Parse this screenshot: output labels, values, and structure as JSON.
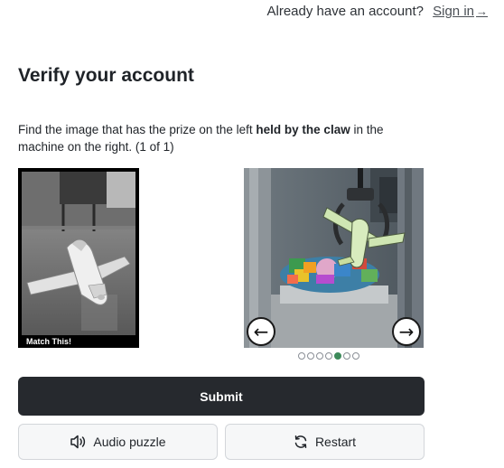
{
  "header": {
    "prompt_text": "Already have an account?",
    "signin_label": "Sign in",
    "signin_arrow": "→"
  },
  "title": "Verify your account",
  "instructions": {
    "part1": "Find the image that has the prize on the left ",
    "bold": "held by the claw",
    "part2": " in the machine on the right. (1 of 1)"
  },
  "target": {
    "label": "Match This!"
  },
  "carousel": {
    "prev_icon": "arrow-left-icon",
    "next_icon": "arrow-right-icon",
    "total": 7,
    "active_index": 4
  },
  "actions": {
    "submit_label": "Submit",
    "audio_label": "Audio puzzle",
    "audio_icon": "speaker-icon",
    "restart_label": "Restart",
    "restart_icon": "refresh-icon"
  },
  "colors": {
    "submit_bg": "#26292e",
    "active_dot": "#3d8a5a"
  }
}
